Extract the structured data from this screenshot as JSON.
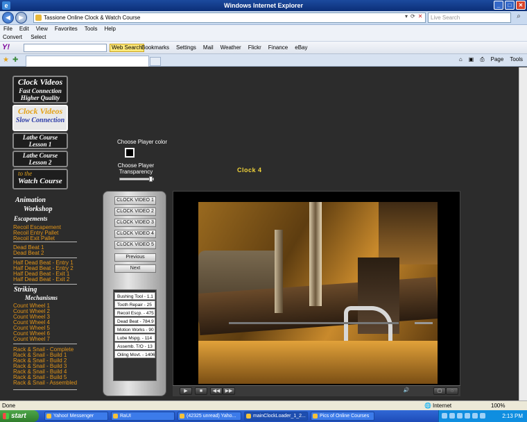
{
  "window": {
    "title": "Windows Internet Explorer"
  },
  "address": {
    "url": "Tassione Online Clock & Watch Course",
    "search_placeholder": "Live Search"
  },
  "menu": [
    "File",
    "Edit",
    "View",
    "Favorites",
    "Tools",
    "Help"
  ],
  "convert_bar": {
    "convert": "Convert",
    "select": "Select"
  },
  "yahoo_bar": {
    "logo": "Y!",
    "web_search": "Web Search",
    "buttons": [
      "Bookmarks",
      "Settings",
      "Mail",
      "Weather",
      "Flickr",
      "Finance",
      "eBay"
    ]
  },
  "command_bar": [
    "Page",
    "Tools"
  ],
  "sidebar": {
    "buttons": [
      {
        "l1": "Clock Videos",
        "l2a": "Fast Connection",
        "l2b": "Higher Quality"
      },
      {
        "l1": "Clock Videos",
        "l2a": "Slow Connection"
      },
      {
        "l1": "Lathe Course",
        "l2a": "Lesson 1"
      },
      {
        "l1": "Lathe Course",
        "l2a": "Lesson 2"
      },
      {
        "l1": "to the",
        "l2a": "Watch Course"
      }
    ],
    "headings": [
      "Animation",
      "Workshop",
      "Escapements",
      "Striking",
      "Mechanisms"
    ],
    "group1": [
      "Recoil Escapement",
      "Recoil Entry Pallet",
      "Recoil Exit Pallet"
    ],
    "group2": [
      "Dead Beat 1",
      "Dead Beat 2"
    ],
    "group3": [
      "Half Dead Beat - Entry 1",
      "Half Dead Beat - Entry 2",
      "Half Dead Beat - Exit 1",
      "Half Dead Beat - Exit 2"
    ],
    "group4": [
      "Count Wheel 1",
      "Count Wheel 2",
      "Count Wheel 3",
      "Count Wheel 4",
      "Count Wheel 5",
      "Count Wheel 6",
      "Count Wheel 7"
    ],
    "group5": [
      "Rack & Snail - Complete",
      "Rack & Snail - Build 1",
      "Rack & Snail - Build 2",
      "Rack & Snail - Build 3",
      "Rack & Snail - Build 4",
      "Rack & Snail - Build 5",
      "Rack & Snail - Assembled"
    ]
  },
  "player_settings": {
    "color_label": "Choose Player color",
    "transparency_label_1": "Choose Player",
    "transparency_label_2": "Transparency",
    "transparency_level": 0.95
  },
  "clip_title": "Clock 4",
  "video_buttons": [
    "CLOCK VIDEO 1",
    "CLOCK VIDEO 2",
    "CLOCK VIDEO 3",
    "CLOCK VIDEO 4",
    "CLOCK VIDEO 5",
    "Previous",
    "Next"
  ],
  "playlist": [
    "Bushing Tool - 1.1",
    "Tooth Repair - 25",
    "Recoil Escp. - 475",
    "Dead Beat - 784.9",
    "Motion Works - 90",
    "Lube Mspg. - 114",
    "Assemb. T/O - 13",
    "Oiling Movt. - 1406"
  ],
  "status": {
    "left": "Done",
    "zone": "Internet",
    "zoom": "100%"
  },
  "taskbar": {
    "start": "start",
    "items": [
      "Yahoo! Messenger",
      "RaUI",
      "(42325 unread) Yaho...",
      "mainClockLoader_1_2...",
      "Pics of Online Courses"
    ],
    "clock": "2:13 PM"
  }
}
